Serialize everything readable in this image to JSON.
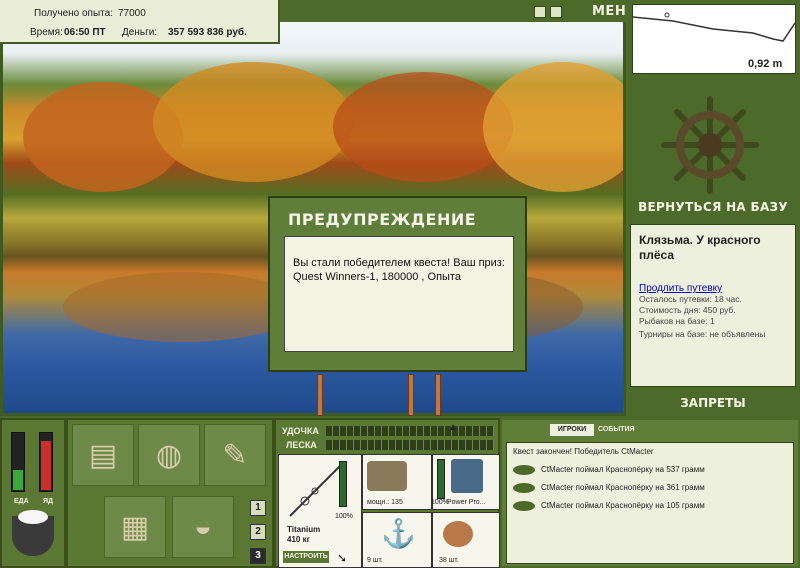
{
  "top_info": {
    "experience_label": "Получено опыта:",
    "experience_value": "77000",
    "time_label": "Время:",
    "time_value": "06:50 ПТ",
    "money_label": "Деньги:",
    "money_value": "357 593 836 руб."
  },
  "menu_label": "МЕНЮ",
  "map": {
    "depth": "0,92 m"
  },
  "right_panel": {
    "return_to_base": "ВЕРНУТЬСЯ НА БАЗУ",
    "location_title": "Клязьма. У красного плёса",
    "extend_link": "Продлить путевку",
    "info_lines": [
      "Осталось путевки: 18 час.",
      "Стоимость дня: 450 руб.",
      "Рыбаков на базе: 1",
      "Турниры на базе: не объявлены"
    ],
    "bans": "ЗАПРЕТЫ"
  },
  "dialog": {
    "title": "ПРЕДУПРЕЖДЕНИЕ",
    "message": "Вы стали победителем квеста! Ваш приз: Quest Winners-1, 180000 , Опыта"
  },
  "status_bars": {
    "food_label": "ЕДА",
    "poison_label": "ЯД",
    "food_level": 0.35,
    "poison_level": 0.85
  },
  "slots": [
    "1",
    "2",
    "3"
  ],
  "tackle": {
    "rod_label": "УДОЧКА",
    "line_label": "ЛЕСКА",
    "rod_name": "Titanium",
    "rod_weight": "410 кг",
    "configure_button": "НАСТРОИТЬ",
    "rod_percent": "100%",
    "reel_label": "мощн.: 135",
    "reel_percent": "100%",
    "line_item_label": "Power Pro...",
    "hook_count": "9 шт.",
    "bait_count": "38 шт."
  },
  "events": {
    "tab_players": "ИГРОКИ",
    "tab_events": "СОБЫТИЯ",
    "quest_line": "Квест закончен! Победитель CtMacter",
    "catches": [
      "CtMacter поймал Краснопёрку на 537 грамм",
      "CtMacter поймал Краснопёрку на 361 грамм",
      "CtMacter поймал Краснопёрку на 105 грамм"
    ]
  }
}
